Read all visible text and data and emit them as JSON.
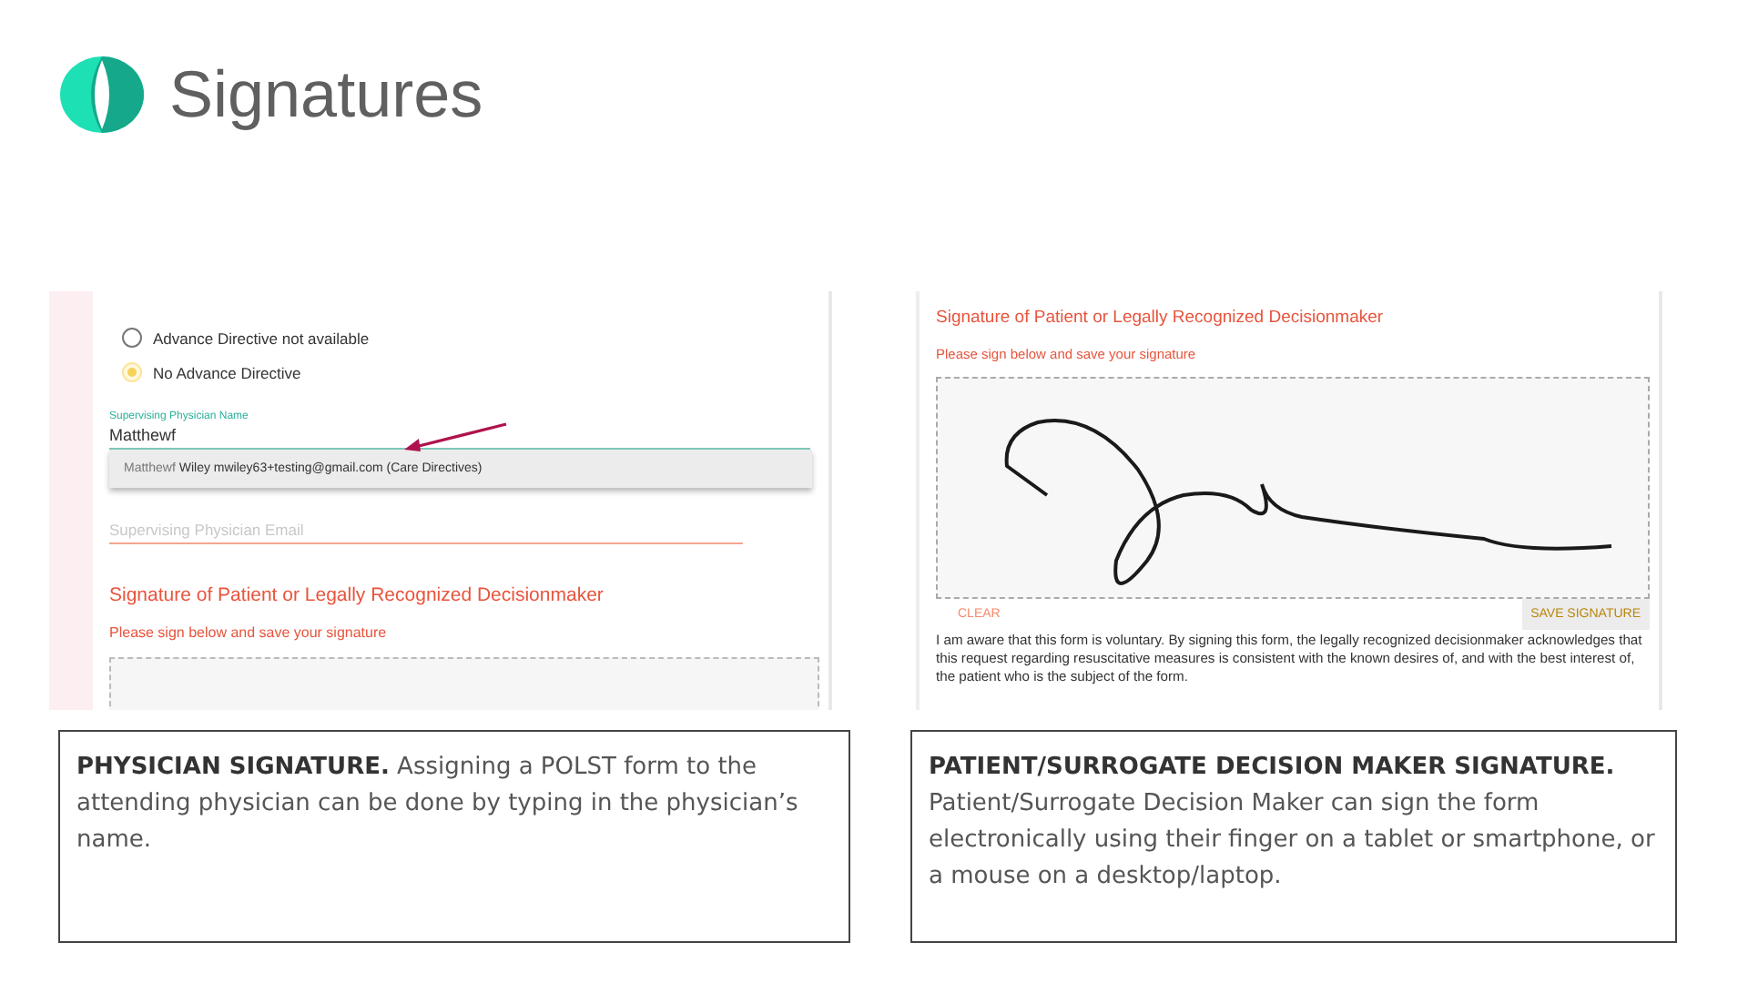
{
  "title": "Signatures",
  "left_screenshot": {
    "options": [
      {
        "label": "Advance Directive not available",
        "selected": false
      },
      {
        "label": "No Advance Directive",
        "selected": true
      }
    ],
    "name_field": {
      "label": "Supervising Physician Name",
      "value": "Matthewf"
    },
    "suggestion": {
      "match": "Matthewf",
      "rest": "Wiley mwiley63+testing@gmail.com (Care Directives)"
    },
    "email_field": {
      "placeholder": "Supervising Physician Email"
    },
    "heading": "Signature of Patient or Legally Recognized Decisionmaker",
    "subheading": "Please sign below and save your signature"
  },
  "right_screenshot": {
    "heading": "Signature of Patient or Legally Recognized Decisionmaker",
    "subheading": "Please sign below and save your signature",
    "clear_button": "CLEAR",
    "save_button": "SAVE SIGNATURE",
    "statement": "I am aware that this form is voluntary. By signing this form, the legally recognized decisionmaker acknowledges that this request regarding resuscitative measures is consistent with the known desires of, and with the best interest of, the patient who is the subject of the form."
  },
  "captions": [
    {
      "kind": "inline",
      "text": "**PHYSICIAN SIGNATURE.** Assigning a POLST form to the attending physician can be done by typing in the physician’s name."
    },
    {
      "kind": "heading",
      "heading": "PATIENT/SURROGATE DECISION MAKER SIGNATURE.",
      "text": "Patient/Surrogate Decision Maker can sign the form electronically using their finger on a tablet or smartphone, or a mouse on a desktop/laptop."
    }
  ]
}
